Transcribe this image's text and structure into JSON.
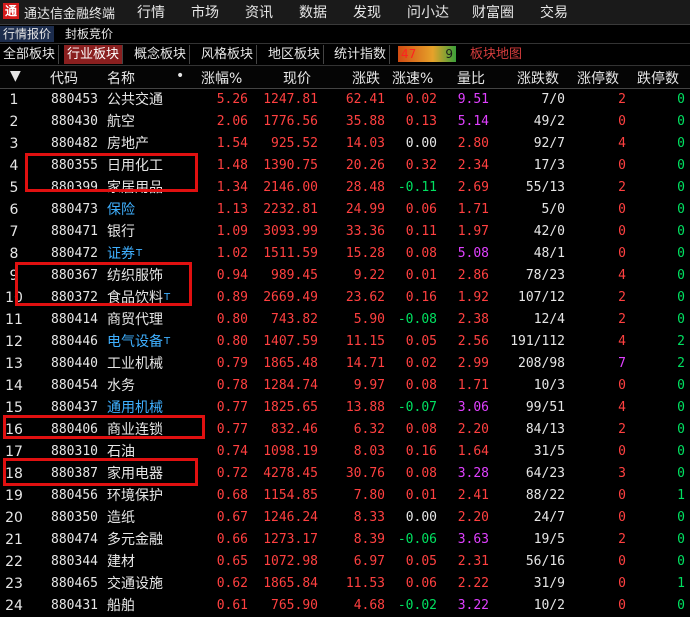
{
  "app": {
    "title": "通达信金融终端",
    "logo": "通"
  },
  "menu": [
    "行情",
    "市场",
    "资讯",
    "数据",
    "发现",
    "问小达",
    "财富圈",
    "交易"
  ],
  "subtabs": [
    "行情报价",
    "封板竞价"
  ],
  "category_tabs": [
    "全部板块",
    "行业板块",
    "概念板块",
    "风格板块",
    "地区板块",
    "统计指数"
  ],
  "active_category": "行业板块",
  "counter": {
    "left": "47",
    "right": "9"
  },
  "map_link": "板块地图",
  "columns": [
    "代码",
    "名称",
    "涨幅%",
    "现价",
    "涨跌",
    "涨速%",
    "量比",
    "涨跌数",
    "涨停数",
    "跌停数"
  ],
  "sort_arrow": "▼",
  "name_dot": "•",
  "rows": [
    {
      "idx": "1",
      "code": "880453",
      "name": "公共交通",
      "pct": "5.26",
      "price": "1247.81",
      "chg": "62.41",
      "spd": "0.02",
      "ratio": "9.51",
      "updn": "7/0",
      "up": "2",
      "dn": "0"
    },
    {
      "idx": "2",
      "code": "880430",
      "name": "航空",
      "pct": "2.06",
      "price": "1776.56",
      "chg": "35.88",
      "spd": "0.13",
      "ratio": "5.14",
      "updn": "49/2",
      "up": "0",
      "dn": "0"
    },
    {
      "idx": "3",
      "code": "880482",
      "name": "房地产",
      "pct": "1.54",
      "price": "925.52",
      "chg": "14.03",
      "spd": "0.00",
      "ratio": "2.80",
      "updn": "92/7",
      "up": "4",
      "dn": "0"
    },
    {
      "idx": "4",
      "code": "880355",
      "name": "日用化工",
      "pct": "1.48",
      "price": "1390.75",
      "chg": "20.26",
      "spd": "0.32",
      "ratio": "2.34",
      "updn": "17/3",
      "up": "0",
      "dn": "0"
    },
    {
      "idx": "5",
      "code": "880399",
      "name": "家居用品",
      "pct": "1.34",
      "price": "2146.00",
      "chg": "28.48",
      "spd": "-0.11",
      "ratio": "2.69",
      "updn": "55/13",
      "up": "2",
      "dn": "0"
    },
    {
      "idx": "6",
      "code": "880473",
      "name": "保险",
      "pct": "1.13",
      "price": "2232.81",
      "chg": "24.99",
      "spd": "0.06",
      "ratio": "1.71",
      "updn": "5/0",
      "up": "0",
      "dn": "0"
    },
    {
      "idx": "7",
      "code": "880471",
      "name": "银行",
      "pct": "1.09",
      "price": "3093.99",
      "chg": "33.36",
      "spd": "0.11",
      "ratio": "1.97",
      "updn": "42/0",
      "up": "0",
      "dn": "0"
    },
    {
      "idx": "8",
      "code": "880472",
      "name": "证券",
      "pct": "1.02",
      "price": "1511.59",
      "chg": "15.28",
      "spd": "0.08",
      "ratio": "5.08",
      "updn": "48/1",
      "up": "0",
      "dn": "0"
    },
    {
      "idx": "9",
      "code": "880367",
      "name": "纺织服饰",
      "pct": "0.94",
      "price": "989.45",
      "chg": "9.22",
      "spd": "0.01",
      "ratio": "2.86",
      "updn": "78/23",
      "up": "4",
      "dn": "0"
    },
    {
      "idx": "10",
      "code": "880372",
      "name": "食品饮料",
      "pct": "0.89",
      "price": "2669.49",
      "chg": "23.62",
      "spd": "0.16",
      "ratio": "1.92",
      "updn": "107/12",
      "up": "2",
      "dn": "0"
    },
    {
      "idx": "11",
      "code": "880414",
      "name": "商贸代理",
      "pct": "0.80",
      "price": "743.82",
      "chg": "5.90",
      "spd": "-0.08",
      "ratio": "2.38",
      "updn": "12/4",
      "up": "2",
      "dn": "0"
    },
    {
      "idx": "12",
      "code": "880446",
      "name": "电气设备",
      "pct": "0.80",
      "price": "1407.59",
      "chg": "11.15",
      "spd": "0.05",
      "ratio": "2.56",
      "updn": "191/112",
      "up": "4",
      "dn": "2"
    },
    {
      "idx": "13",
      "code": "880440",
      "name": "工业机械",
      "pct": "0.79",
      "price": "1865.48",
      "chg": "14.71",
      "spd": "0.02",
      "ratio": "2.99",
      "updn": "208/98",
      "up": "7",
      "dn": "2"
    },
    {
      "idx": "14",
      "code": "880454",
      "name": "水务",
      "pct": "0.78",
      "price": "1284.74",
      "chg": "9.97",
      "spd": "0.08",
      "ratio": "1.71",
      "updn": "10/3",
      "up": "0",
      "dn": "0"
    },
    {
      "idx": "15",
      "code": "880437",
      "name": "通用机械",
      "pct": "0.77",
      "price": "1825.65",
      "chg": "13.88",
      "spd": "-0.07",
      "ratio": "3.06",
      "updn": "99/51",
      "up": "4",
      "dn": "0"
    },
    {
      "idx": "16",
      "code": "880406",
      "name": "商业连锁",
      "pct": "0.77",
      "price": "832.46",
      "chg": "6.32",
      "spd": "0.08",
      "ratio": "2.20",
      "updn": "84/13",
      "up": "2",
      "dn": "0"
    },
    {
      "idx": "17",
      "code": "880310",
      "name": "石油",
      "pct": "0.74",
      "price": "1098.19",
      "chg": "8.03",
      "spd": "0.16",
      "ratio": "1.64",
      "updn": "31/5",
      "up": "0",
      "dn": "0"
    },
    {
      "idx": "18",
      "code": "880387",
      "name": "家用电器",
      "pct": "0.72",
      "price": "4278.45",
      "chg": "30.76",
      "spd": "0.08",
      "ratio": "3.28",
      "updn": "64/23",
      "up": "3",
      "dn": "0"
    },
    {
      "idx": "19",
      "code": "880456",
      "name": "环境保护",
      "pct": "0.68",
      "price": "1154.85",
      "chg": "7.80",
      "spd": "0.01",
      "ratio": "2.41",
      "updn": "88/22",
      "up": "0",
      "dn": "1"
    },
    {
      "idx": "20",
      "code": "880350",
      "name": "造纸",
      "pct": "0.67",
      "price": "1246.24",
      "chg": "8.33",
      "spd": "0.00",
      "ratio": "2.20",
      "updn": "24/7",
      "up": "0",
      "dn": "0"
    },
    {
      "idx": "21",
      "code": "880474",
      "name": "多元金融",
      "pct": "0.66",
      "price": "1273.17",
      "chg": "8.39",
      "spd": "-0.06",
      "ratio": "3.63",
      "updn": "19/5",
      "up": "2",
      "dn": "0"
    },
    {
      "idx": "22",
      "code": "880344",
      "name": "建材",
      "pct": "0.65",
      "price": "1072.98",
      "chg": "6.97",
      "spd": "0.05",
      "ratio": "2.31",
      "updn": "56/16",
      "up": "0",
      "dn": "0"
    },
    {
      "idx": "23",
      "code": "880465",
      "name": "交通设施",
      "pct": "0.62",
      "price": "1865.84",
      "chg": "11.53",
      "spd": "0.06",
      "ratio": "2.22",
      "updn": "31/9",
      "up": "0",
      "dn": "1"
    },
    {
      "idx": "24",
      "code": "880431",
      "name": "船舶",
      "pct": "0.61",
      "price": "765.90",
      "chg": "4.68",
      "spd": "-0.02",
      "ratio": "3.22",
      "updn": "10/2",
      "up": "0",
      "dn": "0"
    }
  ],
  "blue_names": [
    "保险",
    "证券",
    "电气设备",
    "通用机械"
  ],
  "superscript_T": [
    "证券",
    "食品饮料",
    "电气设备"
  ],
  "magenta_ratio": [
    "9.51",
    "5.14",
    "5.08",
    "3.06",
    "3.28",
    "3.63",
    "3.22"
  ],
  "colors": {
    "up": "#ff4040",
    "down": "#00e060",
    "accent": "#e01010",
    "blue": "#3fb0ff",
    "magenta": "#e040ff"
  }
}
